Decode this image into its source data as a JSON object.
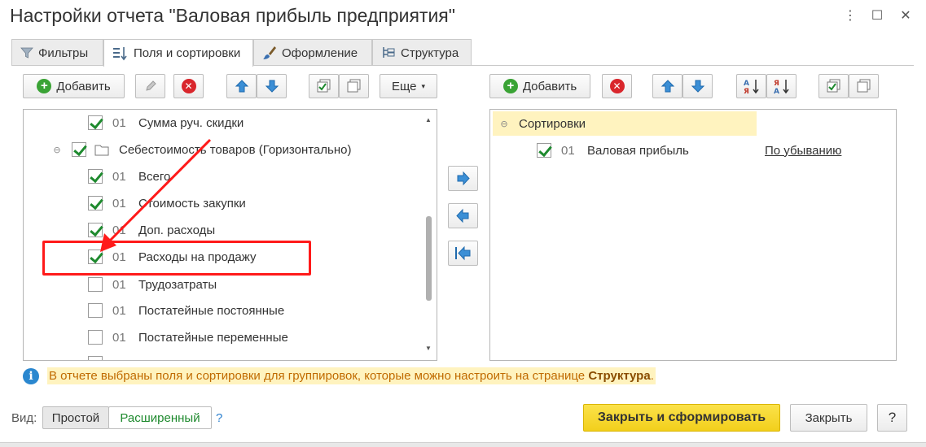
{
  "window": {
    "title": "Настройки отчета \"Валовая прибыль предприятия\"",
    "menu_icon": "⋮",
    "maximize_icon": "☐",
    "close_icon": "✕"
  },
  "tabs": [
    {
      "label": "Фильтры",
      "icon": "filter-icon"
    },
    {
      "label": "Поля и сортировки",
      "icon": "fields-sort-icon"
    },
    {
      "label": "Оформление",
      "icon": "brush-icon"
    },
    {
      "label": "Структура",
      "icon": "structure-icon"
    }
  ],
  "left_toolbar": {
    "add_label": "Добавить",
    "more_label": "Еще",
    "more_caret": "▾"
  },
  "right_toolbar": {
    "add_label": "Добавить"
  },
  "fields": [
    {
      "num": "01",
      "label": "Сумма руч. скидки",
      "checked": true
    },
    {
      "num": "",
      "label": "Себестоимость товаров (Горизонтально)",
      "checked": true,
      "group": true
    },
    {
      "num": "01",
      "label": "Всего",
      "checked": true
    },
    {
      "num": "01",
      "label": "Стоимость закупки",
      "checked": true
    },
    {
      "num": "01",
      "label": "Доп. расходы",
      "checked": true
    },
    {
      "num": "01",
      "label": "Расходы на продажу",
      "checked": true
    },
    {
      "num": "01",
      "label": "Трудозатраты",
      "checked": false
    },
    {
      "num": "01",
      "label": "Постатейные постоянные",
      "checked": false
    },
    {
      "num": "01",
      "label": "Постатейные переменные",
      "checked": false
    }
  ],
  "sortings": {
    "header": "Сортировки",
    "items": [
      {
        "num": "01",
        "label": "Валовая прибыль",
        "direction": "По убыванию",
        "checked": true
      }
    ]
  },
  "info": {
    "text": "В отчете выбраны поля и сортировки для группировок, которые можно настроить на странице ",
    "link": "Структура",
    "end": "."
  },
  "footer": {
    "view_label": "Вид:",
    "simple": "Простой",
    "advanced": "Расширенный",
    "help_q": "?",
    "close_generate": "Закрыть и сформировать",
    "close": "Закрыть",
    "help": "?"
  },
  "colors": {
    "primary_button": "#f7d936",
    "highlight": "#ff1a1a",
    "sort_header_bg": "#fff3bf",
    "check": "#1e8a2e"
  }
}
